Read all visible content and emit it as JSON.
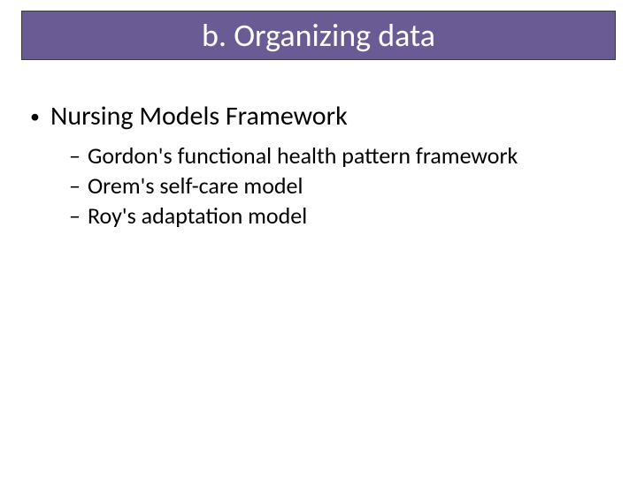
{
  "title": "b. Organizing data",
  "level1": {
    "marker": "•",
    "text": "Nursing Models Framework"
  },
  "level2": [
    {
      "marker": "–",
      "text": "Gordon's functional health pattern framework"
    },
    {
      "marker": "–",
      "text": "Orem's self-care model"
    },
    {
      "marker": "–",
      "text": "Roy's adaptation model"
    }
  ]
}
